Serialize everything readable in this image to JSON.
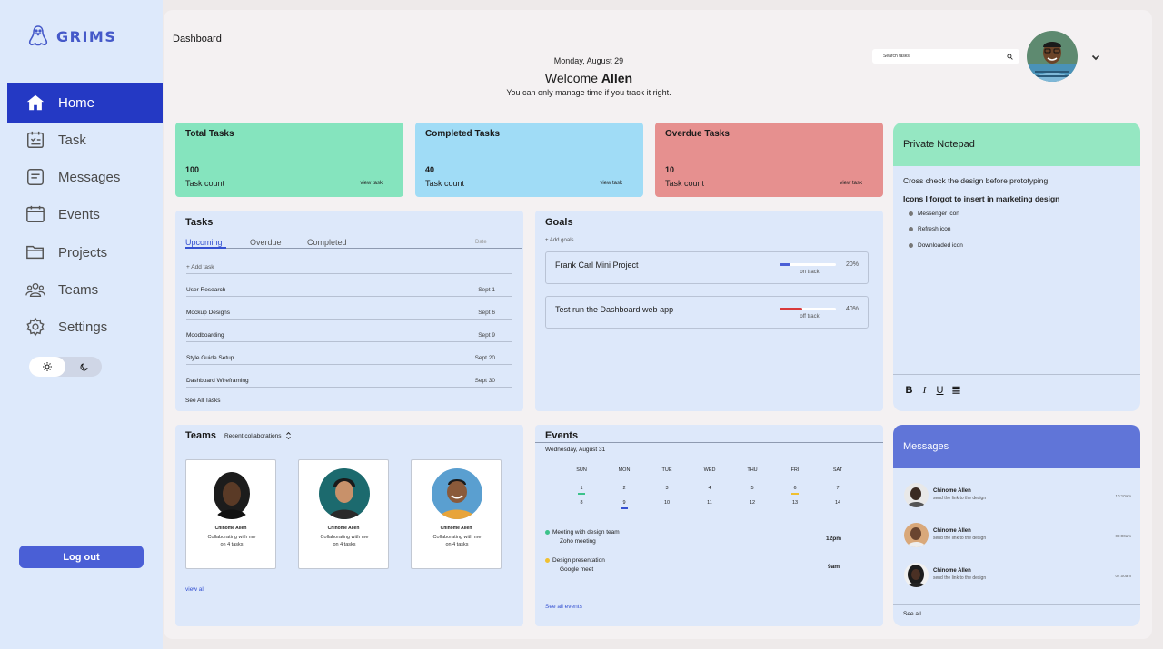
{
  "app": {
    "name": "GRIMS"
  },
  "sidebar": {
    "items": [
      {
        "label": "Home",
        "icon": "home-icon",
        "active": true
      },
      {
        "label": "Task",
        "icon": "task-icon"
      },
      {
        "label": "Messages",
        "icon": "messages-icon"
      },
      {
        "label": "Events",
        "icon": "calendar-icon"
      },
      {
        "label": "Projects",
        "icon": "folder-icon"
      },
      {
        "label": "Teams",
        "icon": "teams-icon"
      },
      {
        "label": "Settings",
        "icon": "gear-icon"
      }
    ],
    "theme": {
      "light_icon": "sun-icon",
      "dark_icon": "moon-icon",
      "selected": "light"
    },
    "logout_label": "Log out"
  },
  "header": {
    "title": "Dashboard",
    "date": "Monday, August 29",
    "welcome_prefix": "Welcome",
    "user_name": "Allen",
    "tagline": "You can only manage time if you track it right.",
    "search_placeholder": "Search tasks"
  },
  "stats": [
    {
      "title": "Total Tasks",
      "count": "100",
      "label": "Task count",
      "link": "view task",
      "color": "#85e4be"
    },
    {
      "title": "Completed Tasks",
      "count": "40",
      "label": "Task count",
      "link": "view task",
      "color": "#a0dcf6"
    },
    {
      "title": "Overdue Tasks",
      "count": "10",
      "label": "Task count",
      "link": "view task",
      "color": "#e6908f"
    }
  ],
  "tasks": {
    "title": "Tasks",
    "tabs": [
      "Upcoming",
      "Overdue",
      "Completed"
    ],
    "active_tab": "Upcoming",
    "date_header": "Date",
    "add_label": "+ Add task",
    "items": [
      {
        "name": "User Research",
        "date": "Sept 1"
      },
      {
        "name": "Mockup Designs",
        "date": "Sept 6"
      },
      {
        "name": "Moodboarding",
        "date": "Sept 9"
      },
      {
        "name": "Style Guide Setup",
        "date": "Sept 20"
      },
      {
        "name": "Dashboard Wireframing",
        "date": "Sept 30"
      }
    ],
    "see_all": "See All Tasks"
  },
  "goals": {
    "title": "Goals",
    "add_label": "+ Add goals",
    "items": [
      {
        "name": "Frank Carl Mini Project",
        "status": "on track",
        "percent": 20,
        "percent_label": "20%",
        "color": "#4a5fd6"
      },
      {
        "name": "Test run the Dashboard web app",
        "status": "off track",
        "percent": 40,
        "percent_label": "40%",
        "color": "#d93a3a"
      }
    ]
  },
  "notepad": {
    "title": "Private Notepad",
    "line1": "Cross check the design before prototyping",
    "line2": "Icons I forgot to insert in marketing design",
    "bullets": [
      "Messenger icon",
      "Refresh icon",
      "Downloaded icon"
    ],
    "format_buttons": [
      "B",
      "I",
      "U"
    ]
  },
  "teams": {
    "title": "Teams",
    "filter": "Recent collaborations",
    "members": [
      {
        "name": "Chinome Allen",
        "desc": "Collaborating with me on 4 tasks"
      },
      {
        "name": "Chinome Allen",
        "desc": "Collaborating with me on 4 tasks"
      },
      {
        "name": "Chinome Allen",
        "desc": "Collaborating with me on 4 tasks"
      }
    ],
    "view_all": "view all"
  },
  "events": {
    "title": "Events",
    "date": "Wednesday, August 31",
    "weekdays": [
      "SUN",
      "MON",
      "TUE",
      "WED",
      "THU",
      "FRI",
      "SAT"
    ],
    "week1": [
      "1",
      "2",
      "3",
      "4",
      "5",
      "6",
      "7"
    ],
    "week2": [
      "8",
      "9",
      "10",
      "11",
      "12",
      "13",
      "14"
    ],
    "items": [
      {
        "title": "Meeting with design team",
        "sub": "Zoho meeting",
        "time": "12pm",
        "color": "#3cc28a"
      },
      {
        "title": "Design presentation",
        "sub": "Google meet",
        "time": "9am",
        "color": "#f0c030"
      }
    ],
    "see_all": "See all events"
  },
  "messages": {
    "title": "Messages",
    "items": [
      {
        "name": "Chinome Allen",
        "text": "send the link to the design",
        "time": "10:10am"
      },
      {
        "name": "Chinome Allen",
        "text": "send the link to the design",
        "time": "09:00am"
      },
      {
        "name": "Chinome Allen",
        "text": "send the link to the design",
        "time": "07:00am"
      }
    ],
    "see_all": "See all"
  }
}
